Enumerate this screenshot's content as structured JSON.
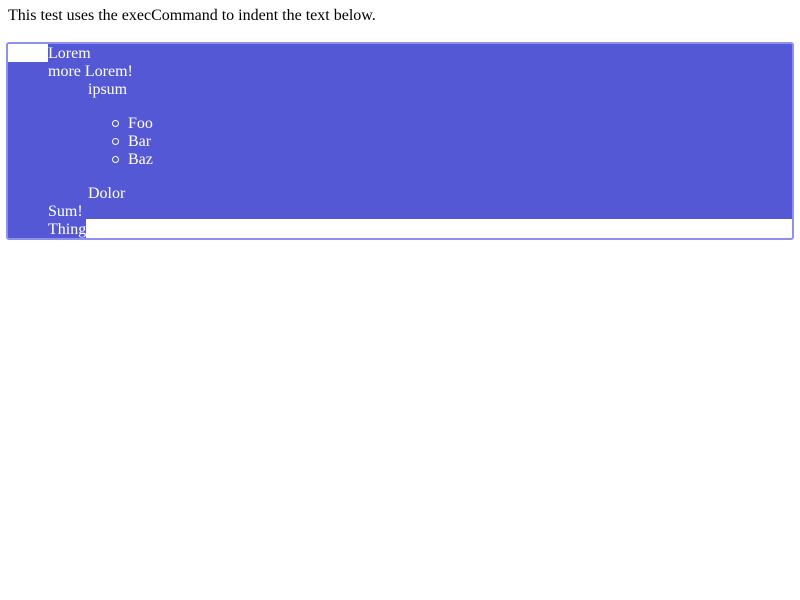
{
  "intro": {
    "text": "This test uses the execCommand to indent the text below."
  },
  "editor": {
    "selection_color": "#5558d5",
    "border_color": "#8f8fef",
    "lines": {
      "lorem": "Lorem",
      "more_lorem": "more Lorem!",
      "ipsum": "ipsum",
      "dolor": "Dolor",
      "sum": "Sum!",
      "thing": "Thing"
    },
    "list_items": [
      "Foo",
      "Bar",
      "Baz"
    ]
  }
}
